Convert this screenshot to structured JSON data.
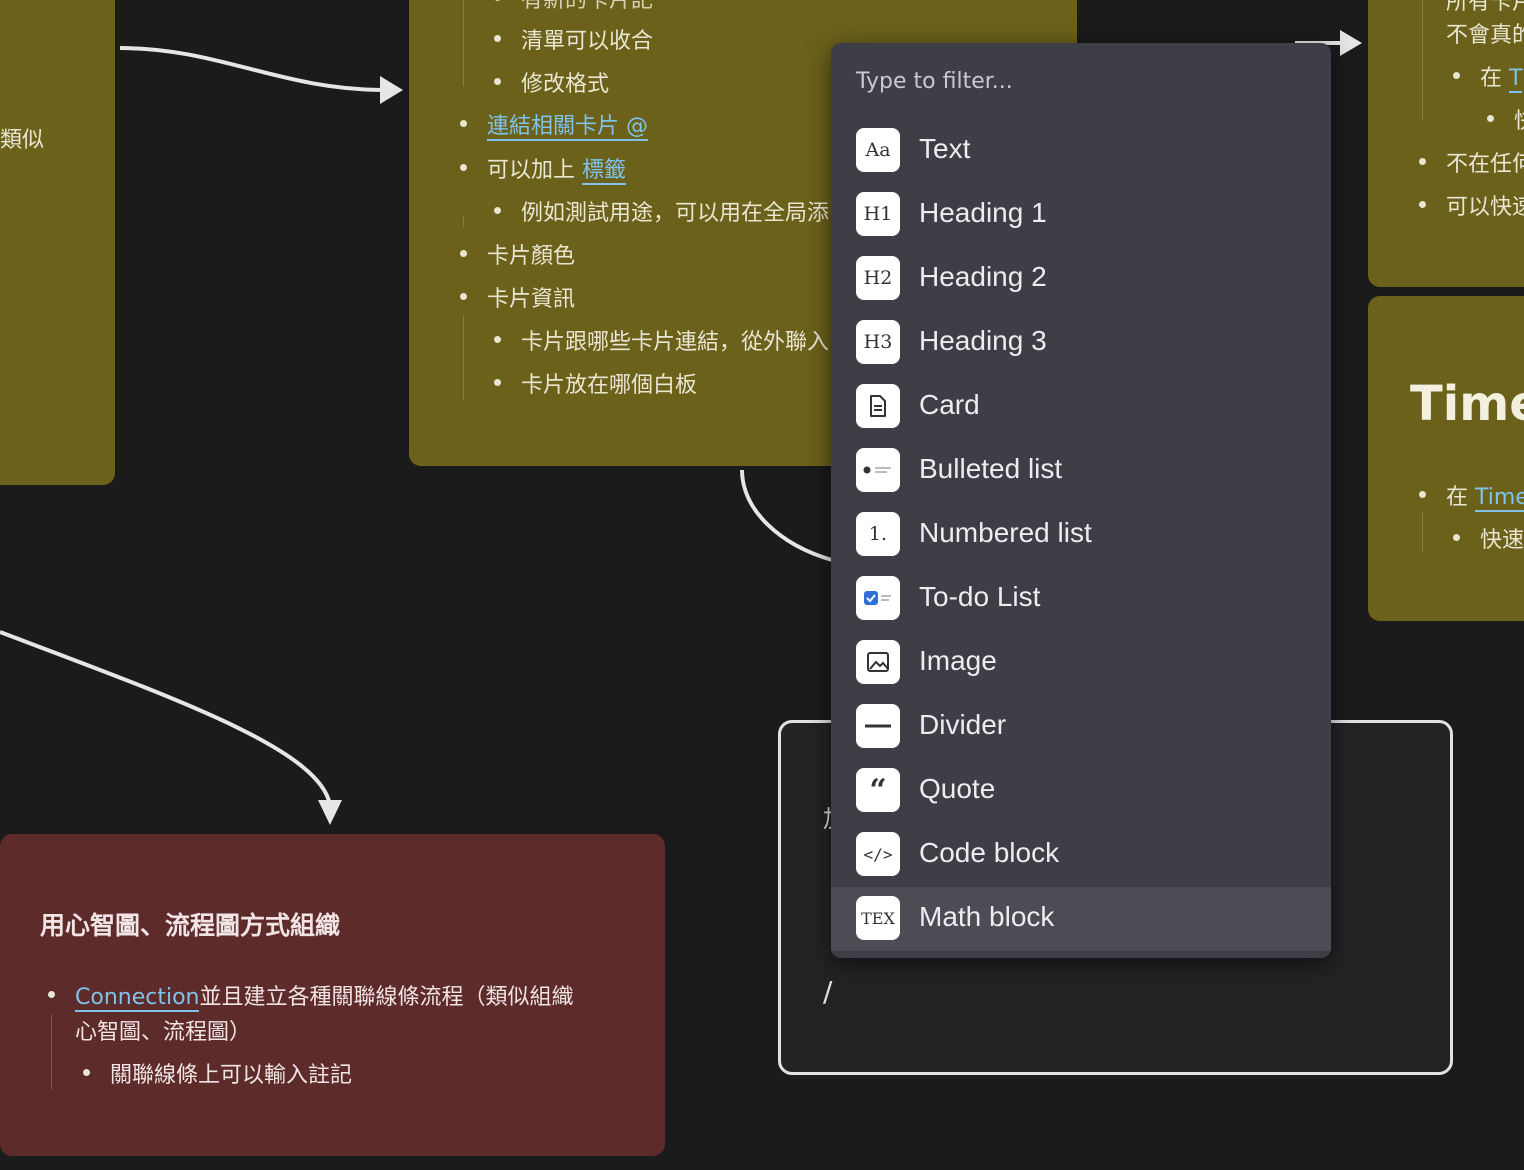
{
  "cards": {
    "left_partial": {
      "text": "類似"
    },
    "center": {
      "top_cut": "有新的卡片記",
      "items": [
        {
          "label": "清單可以收合"
        },
        {
          "label": "修改格式"
        },
        {
          "link": "連結相關卡片 @"
        },
        {
          "prefix": "可以加上 ",
          "link": "標籤"
        },
        {
          "label": "例如測試用途，可以用在全局添"
        },
        {
          "label": "卡片顏色"
        },
        {
          "label": "卡片資訊"
        },
        {
          "label": "卡片跟哪些卡片連結，從外聯入"
        },
        {
          "label": "卡片放在哪個白板"
        }
      ]
    },
    "right_top": {
      "lines": [
        "所有卡片",
        "不會真的",
        "在 ",
        "T",
        "快",
        "不在任何",
        "可以快速"
      ]
    },
    "right_mid": {
      "title": "Time",
      "prefix": "在 ",
      "link": "Time",
      "sub": "快速"
    },
    "red": {
      "title": "用心智圖、流程圖方式組織",
      "link": "Connection",
      "line1": "並且建立各種關聯線條流程（類似組織",
      "line2": "心智圖、流程圖）",
      "sub": "關聯線條上可以輸入註記"
    },
    "editor": {
      "first_char": "加",
      "typed": "/"
    }
  },
  "menu": {
    "placeholder": "Type to filter...",
    "items": [
      {
        "label": "Text",
        "icon": "text-aa-icon",
        "glyph": "Aa"
      },
      {
        "label": "Heading 1",
        "icon": "heading-1-icon",
        "glyph": "H1"
      },
      {
        "label": "Heading 2",
        "icon": "heading-2-icon",
        "glyph": "H2"
      },
      {
        "label": "Heading 3",
        "icon": "heading-3-icon",
        "glyph": "H3"
      },
      {
        "label": "Card",
        "icon": "card-document-icon",
        "glyph": ""
      },
      {
        "label": "Bulleted list",
        "icon": "bulleted-list-icon",
        "glyph": ""
      },
      {
        "label": "Numbered list",
        "icon": "numbered-list-icon",
        "glyph": "1."
      },
      {
        "label": "To-do List",
        "icon": "todo-checkbox-icon",
        "glyph": ""
      },
      {
        "label": "Image",
        "icon": "image-icon",
        "glyph": ""
      },
      {
        "label": "Divider",
        "icon": "divider-icon",
        "glyph": ""
      },
      {
        "label": "Quote",
        "icon": "quote-icon",
        "glyph": "“"
      },
      {
        "label": "Code block",
        "icon": "code-block-icon",
        "glyph": "</>"
      },
      {
        "label": "Math block",
        "icon": "tex-icon",
        "glyph": "TEX",
        "highlighted": true
      }
    ]
  },
  "colors": {
    "background": "#1b1b1b",
    "olive_card": "#6b611b",
    "red_card": "#5e2b2b",
    "menu_bg": "#3e3f46",
    "link": "#7fc3e8"
  }
}
